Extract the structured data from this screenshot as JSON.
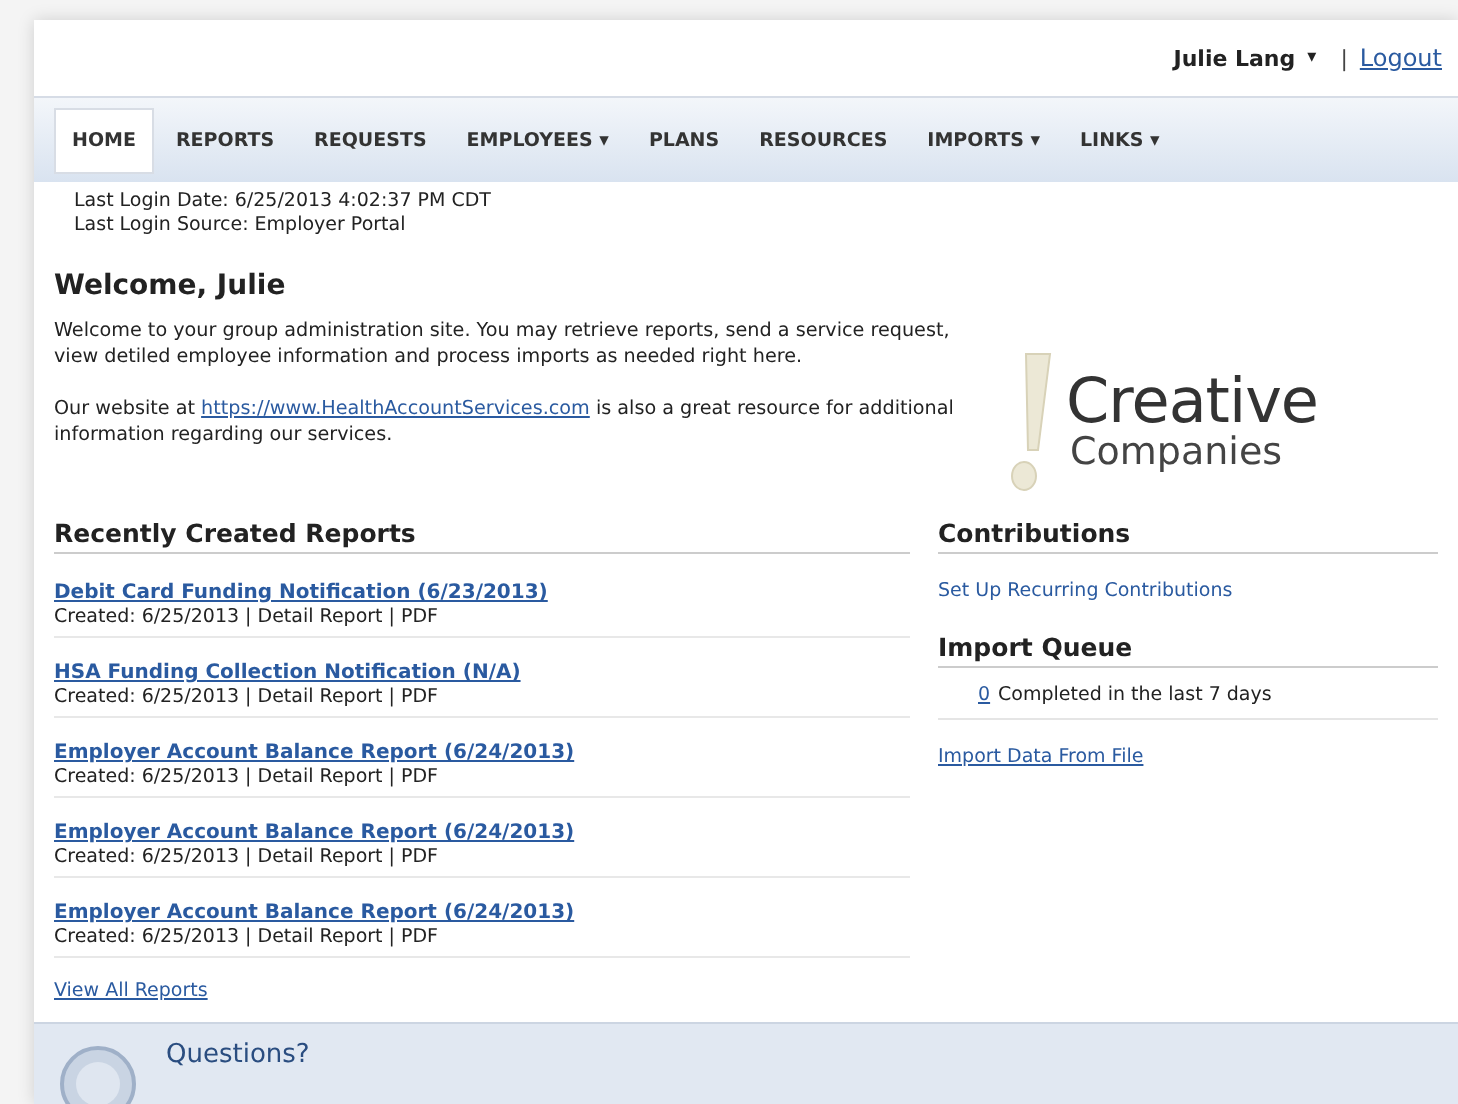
{
  "user_menu": {
    "name": "Julie Lang",
    "caret": "▾",
    "separator": "|",
    "logout": "Logout"
  },
  "nav": [
    {
      "label": "HOME",
      "selected": true
    },
    {
      "label": "REPORTS",
      "selected": false
    },
    {
      "label": "REQUESTS",
      "selected": false
    },
    {
      "label": "EMPLOYEES",
      "selected": false,
      "caret": "▾"
    },
    {
      "label": "PLANS",
      "selected": false
    },
    {
      "label": "RESOURCES",
      "selected": false
    },
    {
      "label": "IMPORTS",
      "selected": false,
      "caret": "▾"
    },
    {
      "label": "LINKS",
      "selected": false,
      "caret": "▾"
    }
  ],
  "login_info": [
    "Last Login Date: 6/25/2013 4:02:37 PM CDT",
    "Last Login Source: Employer Portal"
  ],
  "welcome": {
    "title": "Welcome, Julie",
    "paragraph_1": "Welcome to your group administration site. You may retrieve reports, send a service request, view detiled employee information and process imports as needed right here.",
    "paragraph_2_before": "Our website at",
    "paragraph_2_link": "https://www.HealthAccountServices.com",
    "paragraph_2_after": "is also a great resource for additional information regarding our services."
  },
  "logo": {
    "line_1": "Creative",
    "line_2": "Companies"
  },
  "reports": {
    "title": "Recently Created Reports",
    "items": [
      {
        "title": "Debit Card Funding Notification (6/23/2013)",
        "meta": "Created: 6/25/2013 | Detail Report | PDF"
      },
      {
        "title": "HSA Funding Collection Notification (N/A)",
        "meta": "Created: 6/25/2013 | Detail Report | PDF"
      },
      {
        "title": "Employer Account Balance Report (6/24/2013)",
        "meta": "Created: 6/25/2013 | Detail Report | PDF"
      },
      {
        "title": "Employer Account Balance Report (6/24/2013)",
        "meta": "Created: 6/25/2013 | Detail Report | PDF"
      },
      {
        "title": "Employer Account Balance Report (6/24/2013)",
        "meta": "Created: 6/25/2013 | Detail Report | PDF"
      }
    ],
    "view_all": "View All Reports"
  },
  "contributions": {
    "title": "Contributions",
    "link": "Set Up Recurring Contributions"
  },
  "import_queue": {
    "title": "Import Queue",
    "count": "0",
    "count_text": "Completed in the last 7 days",
    "link": "Import Data From File"
  },
  "footer": {
    "title": "Questions?"
  }
}
